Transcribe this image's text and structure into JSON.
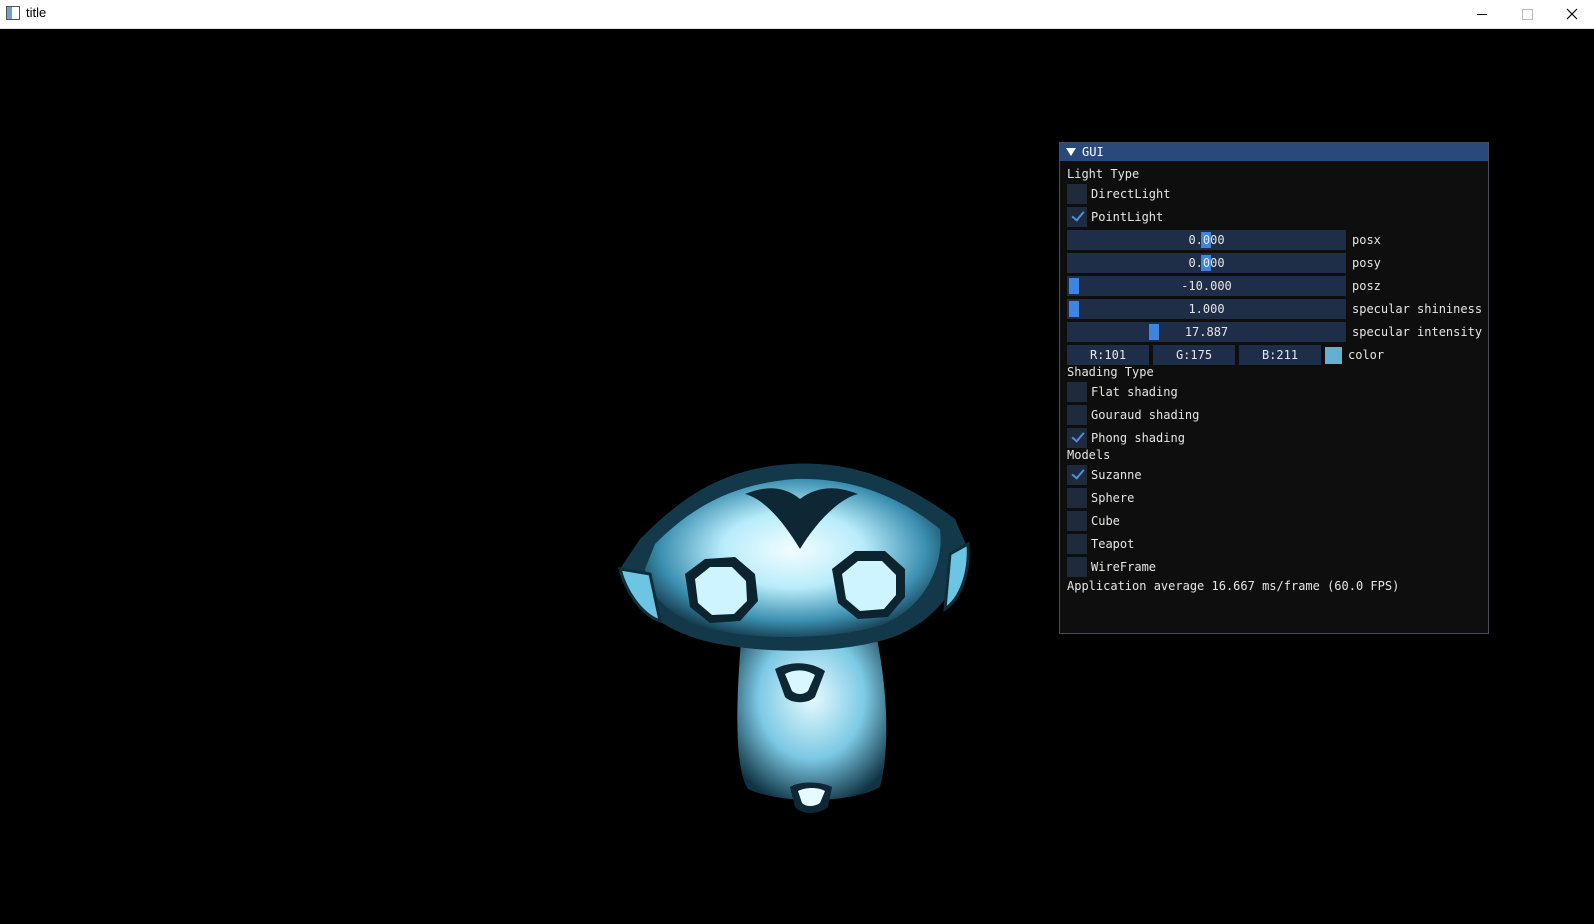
{
  "window": {
    "title": "title",
    "controls": [
      "minimize-icon",
      "maximize-icon",
      "close-icon"
    ]
  },
  "viewport": {
    "model_name": "Suzanne",
    "light_color": "#65afd3"
  },
  "gui": {
    "header": "GUI",
    "light_type_label": "Light Type",
    "light_types": [
      {
        "label": "DirectLight",
        "checked": false
      },
      {
        "label": "PointLight",
        "checked": true
      }
    ],
    "sliders": [
      {
        "label": "posx",
        "value": "0.000",
        "fraction": 0.5
      },
      {
        "label": "posy",
        "value": "0.000",
        "fraction": 0.5
      },
      {
        "label": "posz",
        "value": "-10.000",
        "fraction": 0.0
      },
      {
        "label": "specular shininess",
        "value": "1.000",
        "fraction": 0.0
      },
      {
        "label": "specular intensity",
        "value": "17.887",
        "fraction": 0.3
      }
    ],
    "color": {
      "r": "R:101",
      "g": "G:175",
      "b": "B:211",
      "label": "color",
      "swatch": "#65afd3"
    },
    "shading_type_label": "Shading Type",
    "shading_types": [
      {
        "label": "Flat shading",
        "checked": false
      },
      {
        "label": "Gouraud shading",
        "checked": false
      },
      {
        "label": "Phong shading",
        "checked": true
      }
    ],
    "models_label": "Models",
    "models": [
      {
        "label": "Suzanne",
        "checked": true
      },
      {
        "label": "Sphere",
        "checked": false
      },
      {
        "label": "Cube",
        "checked": false
      },
      {
        "label": "Teapot",
        "checked": false
      },
      {
        "label": "WireFrame",
        "checked": false
      }
    ],
    "fps_text": "Application average 16.667 ms/frame (60.0 FPS)"
  }
}
